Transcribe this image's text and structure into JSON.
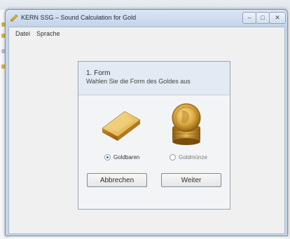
{
  "window": {
    "title": "KERN SSG – Sound Calculation for Gold",
    "minimize_glyph": "–",
    "maximize_glyph": "□",
    "close_glyph": "✕"
  },
  "menu": {
    "items": [
      {
        "label": "Datei"
      },
      {
        "label": "Sprache"
      }
    ]
  },
  "wizard": {
    "step_title": "1. Form",
    "step_description": "Wahlen Sie die Form des Goldes aus",
    "options": [
      {
        "label": "Goldbaren",
        "selected": true,
        "image": "gold-bar-icon"
      },
      {
        "label": "Goldmünze",
        "selected": false,
        "image": "gold-coin-icon"
      }
    ],
    "buttons": {
      "cancel_label": "Abbrechen",
      "next_label": "Weiter"
    }
  },
  "colors": {
    "accent": "#2d6db5",
    "window_frame": "#c6d6e8",
    "gold": "#d6a33a"
  }
}
